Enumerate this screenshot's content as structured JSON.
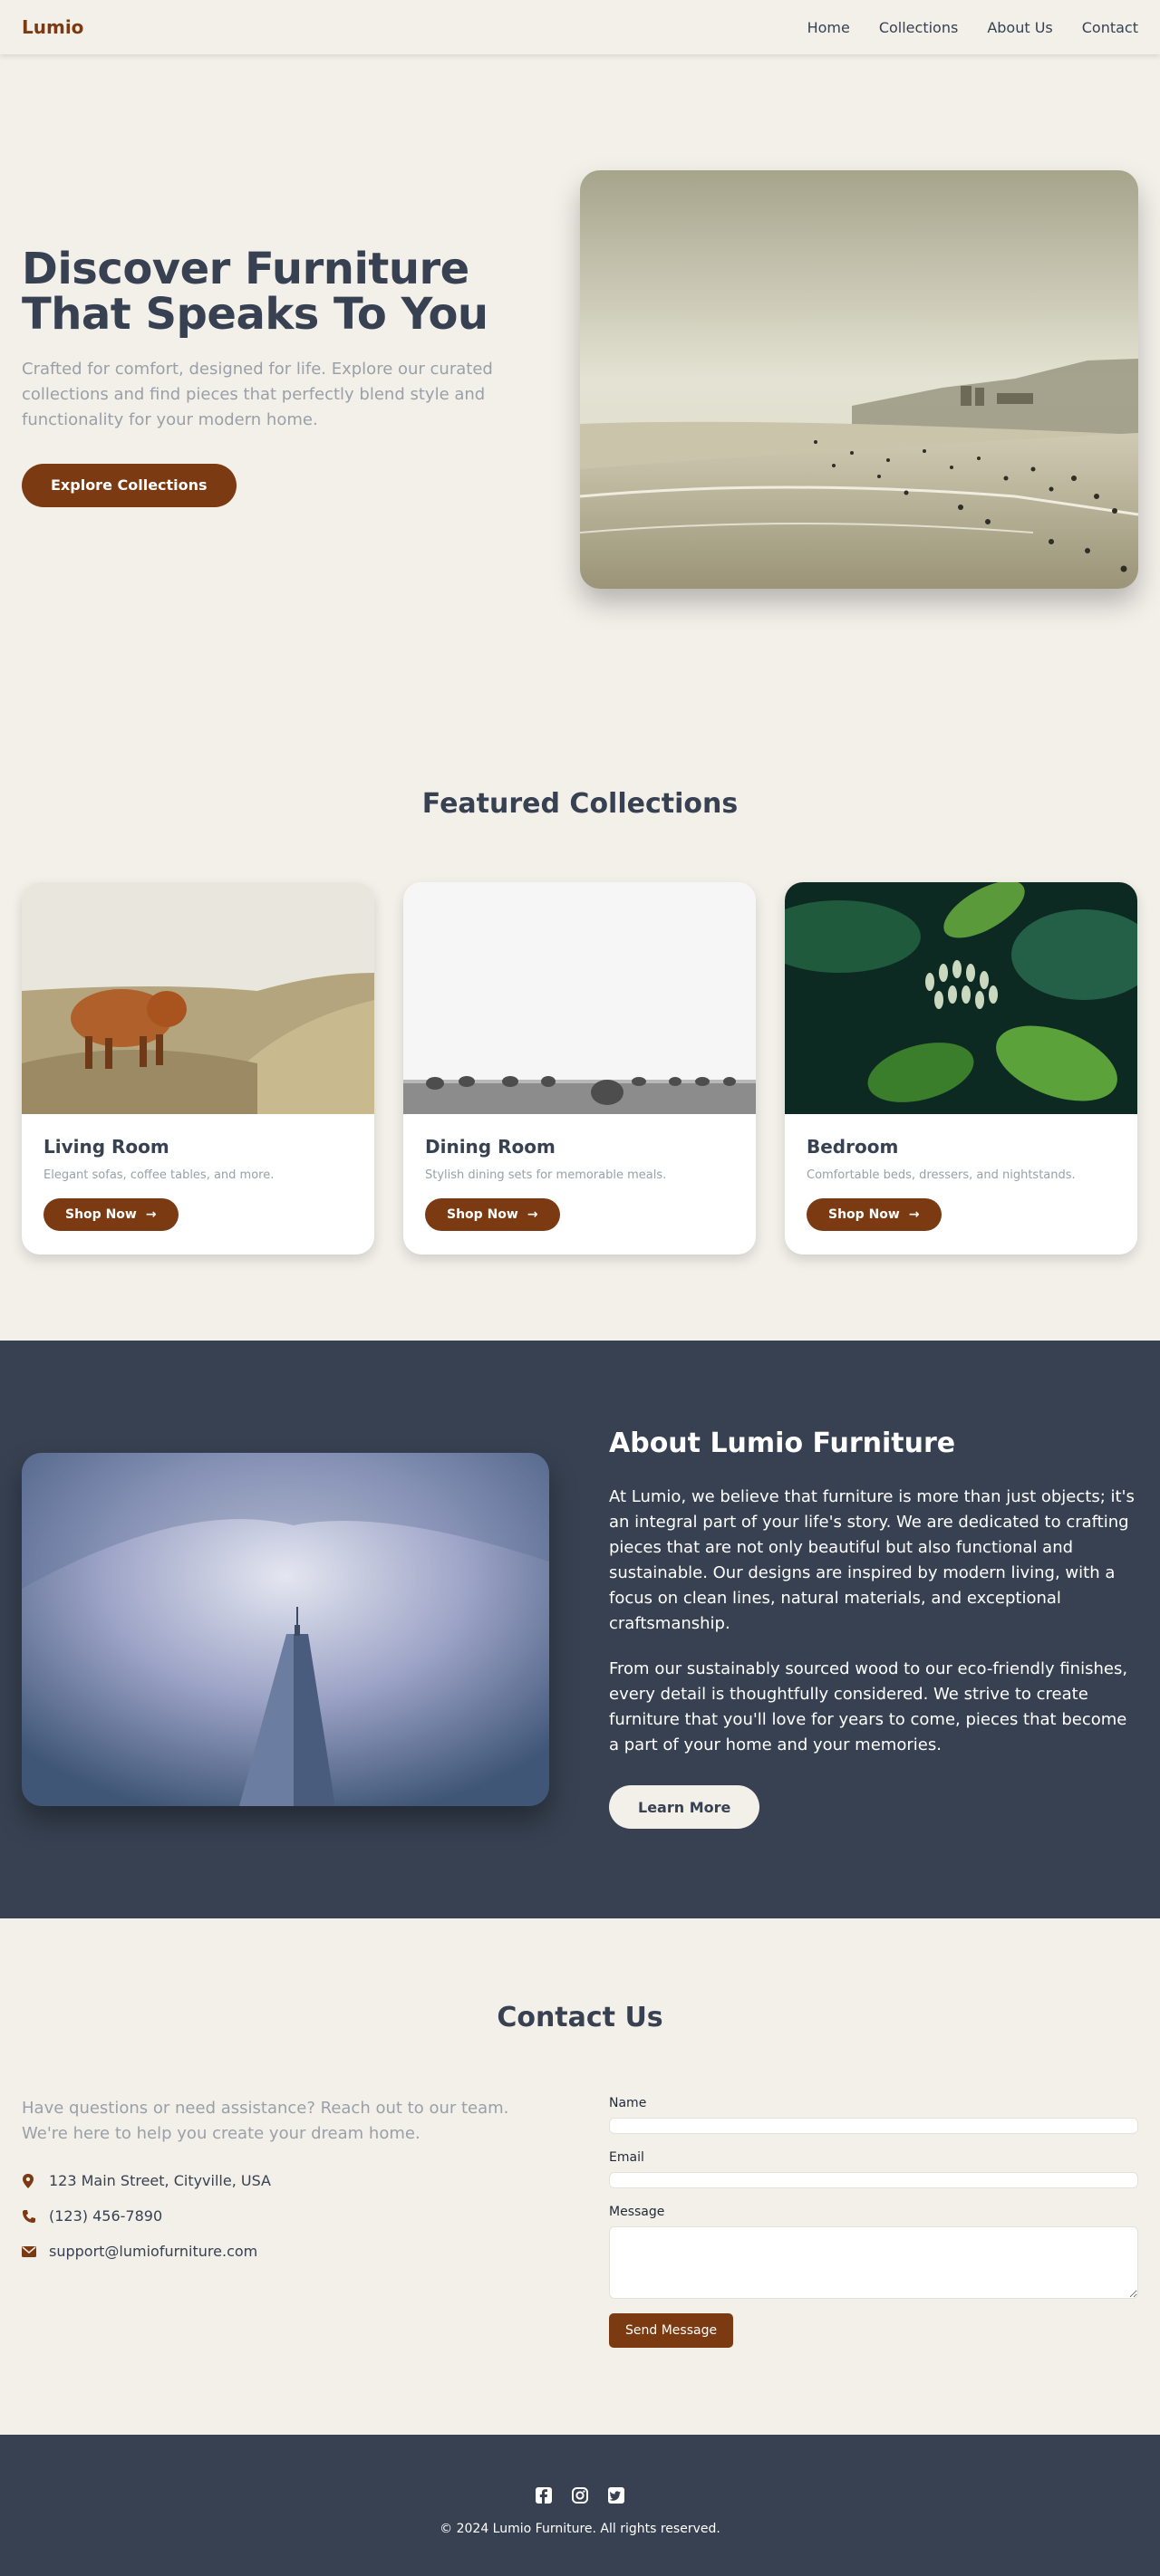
{
  "nav": {
    "logo": "Lumio",
    "links": [
      "Home",
      "Collections",
      "About Us",
      "Contact"
    ]
  },
  "hero": {
    "title": "Discover Furniture That Speaks To You",
    "subtitle": "Crafted for comfort, designed for life. Explore our curated collections and find pieces that perfectly blend style and functionality for your modern home.",
    "cta": "Explore Collections"
  },
  "featured": {
    "title": "Featured Collections",
    "cards": [
      {
        "title": "Living Room",
        "desc": "Elegant sofas, coffee tables, and more.",
        "cta": "Shop Now"
      },
      {
        "title": "Dining Room",
        "desc": "Stylish dining sets for memorable meals.",
        "cta": "Shop Now"
      },
      {
        "title": "Bedroom",
        "desc": "Comfortable beds, dressers, and nightstands.",
        "cta": "Shop Now"
      }
    ]
  },
  "about": {
    "title": "About Lumio Furniture",
    "p1": "At Lumio, we believe that furniture is more than just objects; it's an integral part of your life's story. We are dedicated to crafting pieces that are not only beautiful but also functional and sustainable. Our designs are inspired by modern living, with a focus on clean lines, natural materials, and exceptional craftsmanship.",
    "p2": "From our sustainably sourced wood to our eco-friendly finishes, every detail is thoughtfully considered. We strive to create furniture that you'll love for years to come, pieces that become a part of your home and your memories.",
    "cta": "Learn More"
  },
  "contact": {
    "title": "Contact Us",
    "intro": "Have questions or need assistance? Reach out to our team. We're here to help you create your dream home.",
    "address": "123 Main Street, Cityville, USA",
    "phone": "(123) 456-7890",
    "email": "support@lumiofurniture.com",
    "form": {
      "name_label": "Name",
      "email_label": "Email",
      "message_label": "Message",
      "submit": "Send Message"
    }
  },
  "footer": {
    "copyright": "© 2024 Lumio Furniture. All rights reserved."
  },
  "colors": {
    "brand": "#7c3a12",
    "dark": "#374151",
    "background": "#f3f0ea"
  }
}
